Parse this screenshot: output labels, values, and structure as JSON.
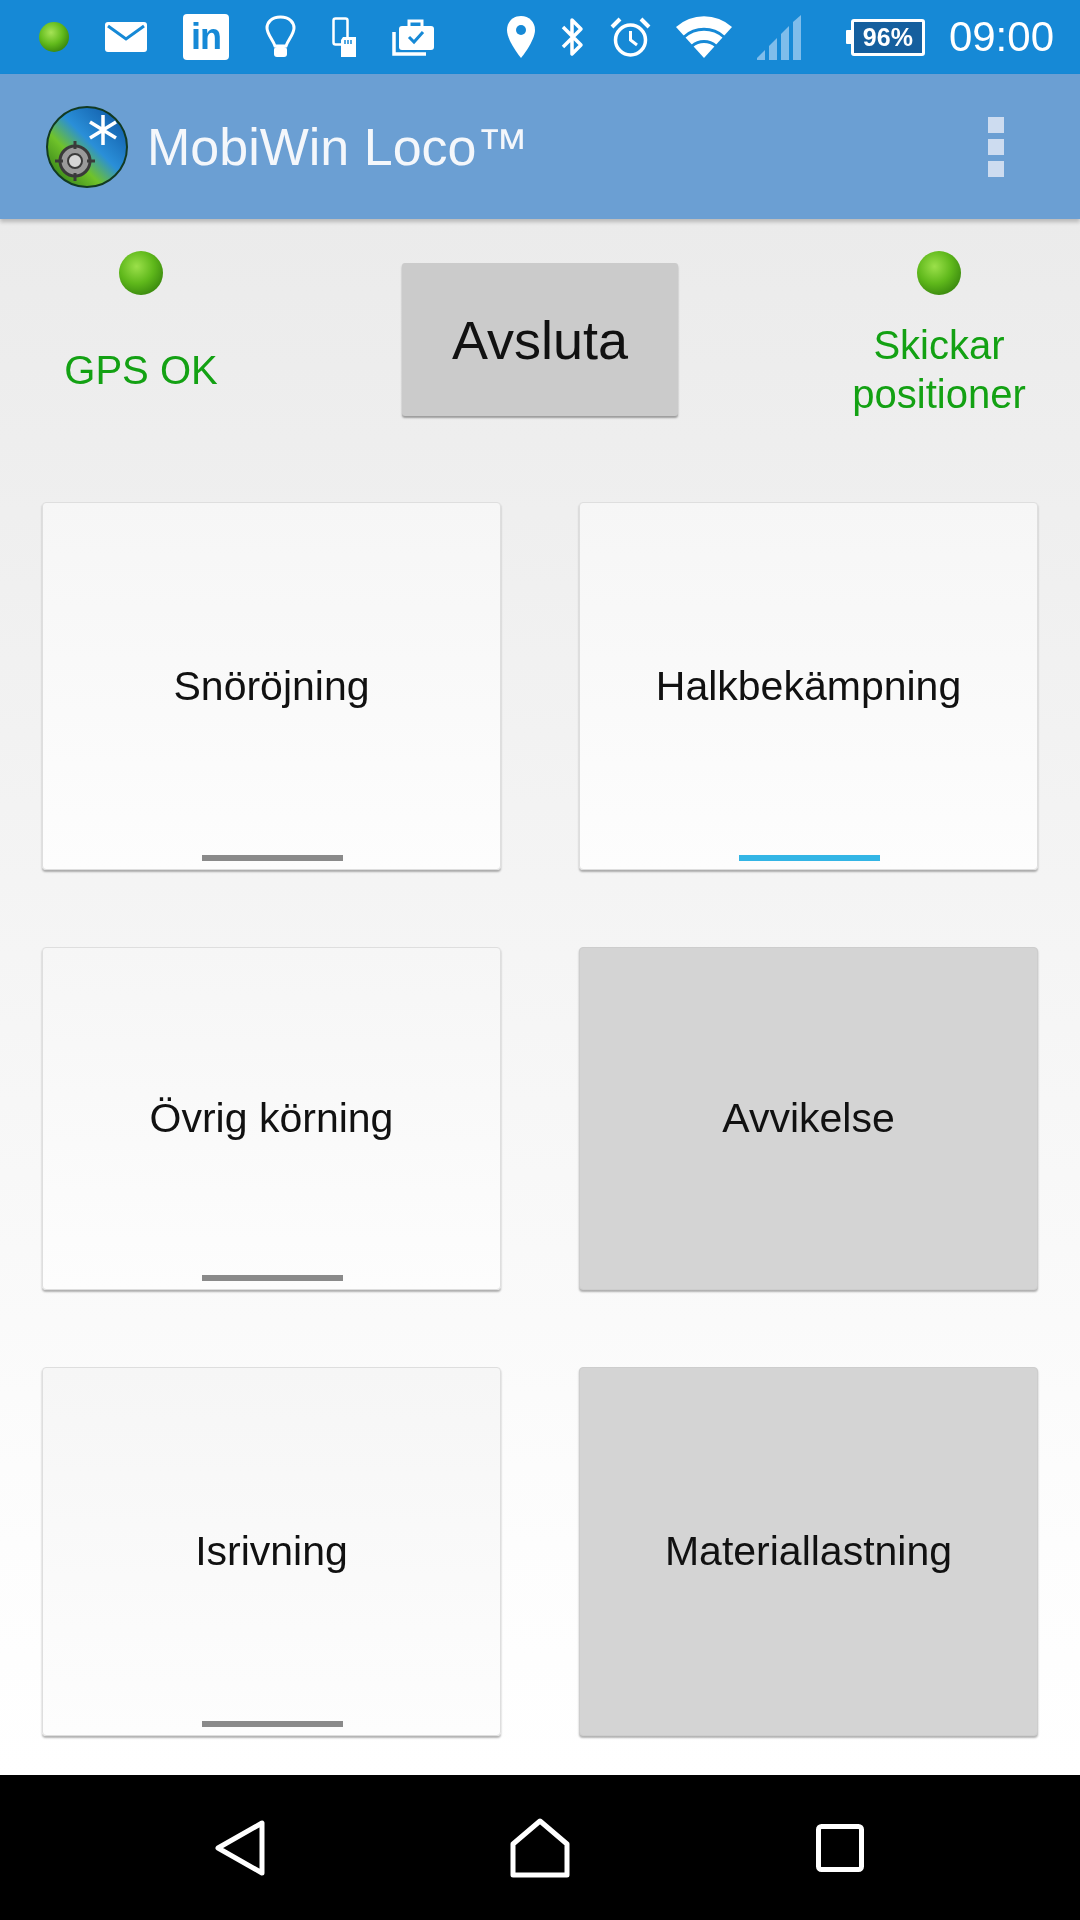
{
  "status_bar": {
    "badge_text": "in",
    "battery": "96%",
    "time": "09:00"
  },
  "app_bar": {
    "title": "MobiWin Loco™"
  },
  "status_panel": {
    "gps_indicator": {
      "label": "GPS OK",
      "on": true
    },
    "exit_button": {
      "label": "Avsluta"
    },
    "sending_indicator": {
      "label": "Skickar positioner",
      "on": true
    }
  },
  "tiles": [
    {
      "label": "Snöröjning",
      "kind": "toggle",
      "on": false
    },
    {
      "label": "Halkbekämpning",
      "kind": "toggle",
      "on": true
    },
    {
      "label": "Övrig körning",
      "kind": "toggle",
      "on": false
    },
    {
      "label": "Avvikelse",
      "kind": "button"
    },
    {
      "label": "Isrivning",
      "kind": "toggle",
      "on": false
    },
    {
      "label": "Materiallastning",
      "kind": "button"
    }
  ]
}
